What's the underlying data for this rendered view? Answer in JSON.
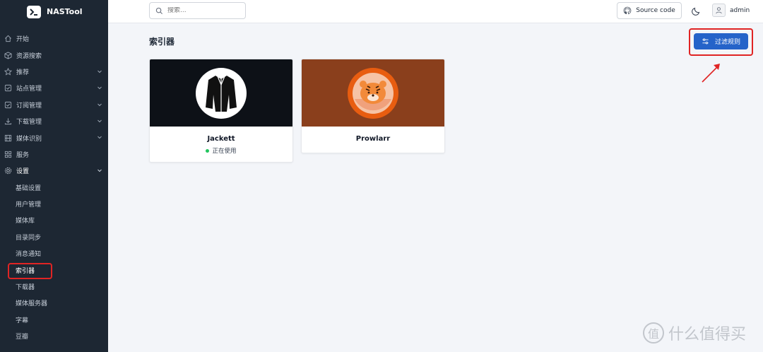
{
  "brand": {
    "name": "NASTool"
  },
  "search": {
    "placeholder": "搜索..."
  },
  "header": {
    "source_label": "Source code",
    "user": "admin"
  },
  "nav": [
    {
      "label": "开始",
      "icon": "home-icon",
      "chevron": false
    },
    {
      "label": "资源搜索",
      "icon": "cube-icon",
      "chevron": false
    },
    {
      "label": "推荐",
      "icon": "star-icon",
      "chevron": true
    },
    {
      "label": "站点管理",
      "icon": "checkbox-icon",
      "chevron": true
    },
    {
      "label": "订阅管理",
      "icon": "checkbox-icon",
      "chevron": true
    },
    {
      "label": "下载管理",
      "icon": "download-icon",
      "chevron": true
    },
    {
      "label": "媒体识别",
      "icon": "film-icon",
      "chevron": true
    },
    {
      "label": "服务",
      "icon": "apps-icon",
      "chevron": false
    },
    {
      "label": "设置",
      "icon": "gear-icon",
      "chevron": true
    }
  ],
  "settings_sub": [
    "基础设置",
    "用户管理",
    "媒体库",
    "目录同步",
    "消息通知",
    "索引器",
    "下载器",
    "媒体服务器",
    "字幕",
    "豆瓣"
  ],
  "main": {
    "title": "索引器",
    "filter_button": "过滤规则",
    "cards": [
      {
        "name": "Jackett",
        "status": "正在使用",
        "bg": "#0d1117"
      },
      {
        "name": "Prowlarr",
        "status": "",
        "bg": "#8a3f1c"
      }
    ]
  },
  "watermark": {
    "text": "什么值得买",
    "glyph": "值"
  },
  "colors": {
    "sidebar": "#1d2733",
    "accent": "#2563c9",
    "highlight": "#e02424",
    "status_ok": "#22c55e"
  }
}
